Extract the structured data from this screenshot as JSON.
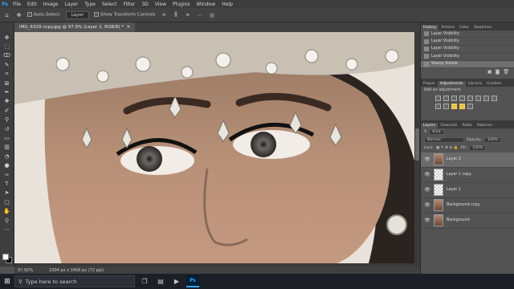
{
  "menubar": {
    "items": [
      "File",
      "Edit",
      "Image",
      "Layer",
      "Type",
      "Select",
      "Filter",
      "3D",
      "View",
      "Plugins",
      "Window",
      "Help"
    ]
  },
  "options": {
    "auto_select": "Auto-Select:",
    "target": "Layer",
    "transform": "Show Transform Controls"
  },
  "document": {
    "tab_title": "IMG_6329 copy.jpg @ 97.9% (Layer 2, RGB/8) *",
    "zoom": "97.92%",
    "size": "2304 px x 3456 px (72 ppi)"
  },
  "panels": {
    "top_tabs": [
      "History",
      "Actions",
      "Color",
      "Swatches"
    ],
    "history_rows": [
      "Layer Visibility",
      "Layer Visibility",
      "Layer Visibility",
      "Layer Visibility",
      "Stamp Visible"
    ],
    "mid_tabs": [
      "Proper",
      "Adjustments",
      "Libraria",
      "Gradien"
    ],
    "add_adjustment": "Add an adjustment",
    "layer_tabs": [
      "Layers",
      "Channels",
      "Paths",
      "Patterns"
    ],
    "kind_label": "Kind",
    "blend_mode": "Normal",
    "opacity_label": "Opacity:",
    "opacity_value": "100%",
    "lock_label": "Lock:",
    "fill_label": "Fill:",
    "fill_value": "100%",
    "layers": [
      "Layer 2",
      "Layer 1 copy",
      "Layer 1",
      "Background copy",
      "Background"
    ]
  },
  "taskbar": {
    "search_placeholder": "Type here to search",
    "ps_label": "Ps"
  },
  "colors": {
    "accent": "#31a8ff",
    "highlight": "#e8c24a"
  }
}
